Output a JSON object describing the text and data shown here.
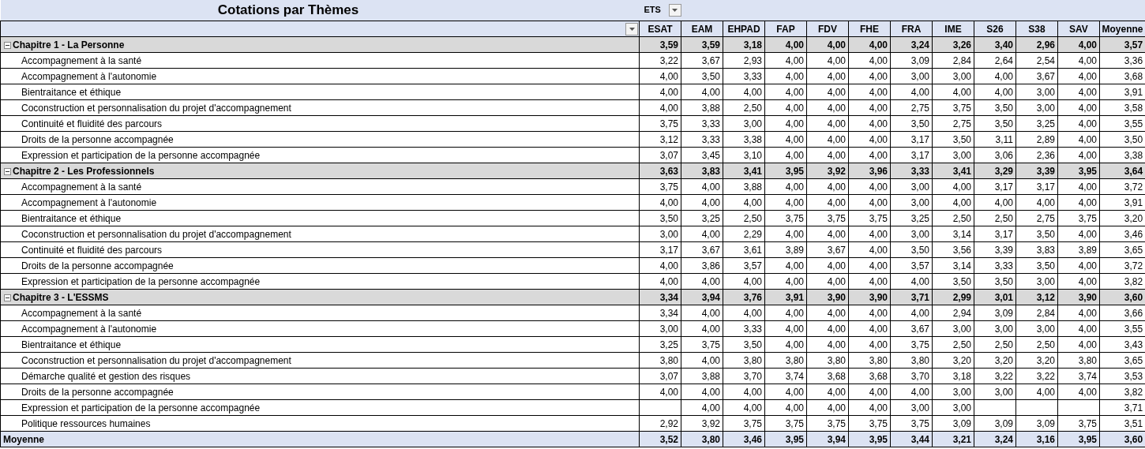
{
  "title": "Cotations par Thèmes",
  "filter": {
    "label": "ETS"
  },
  "columns": [
    "ESAT",
    "EAM",
    "EHPAD",
    "FAP",
    "FDV",
    "FHE",
    "FRA",
    "IME",
    "S26",
    "S38",
    "SAV",
    "Moyenne"
  ],
  "groups": [
    {
      "label": "Chapitre 1 - La Personne",
      "expanded": true,
      "values": [
        "3,59",
        "3,59",
        "3,18",
        "4,00",
        "4,00",
        "4,00",
        "3,24",
        "3,26",
        "3,40",
        "2,96",
        "4,00",
        "3,57"
      ],
      "rows": [
        {
          "label": "Accompagnement à la santé",
          "values": [
            "3,22",
            "3,67",
            "2,93",
            "4,00",
            "4,00",
            "4,00",
            "3,09",
            "2,84",
            "2,64",
            "2,54",
            "4,00",
            "3,36"
          ]
        },
        {
          "label": "Accompagnement à l'autonomie",
          "values": [
            "4,00",
            "3,50",
            "3,33",
            "4,00",
            "4,00",
            "4,00",
            "3,00",
            "3,00",
            "4,00",
            "3,67",
            "4,00",
            "3,68"
          ]
        },
        {
          "label": "Bientraitance et éthique",
          "values": [
            "4,00",
            "4,00",
            "4,00",
            "4,00",
            "4,00",
            "4,00",
            "4,00",
            "4,00",
            "4,00",
            "3,00",
            "4,00",
            "3,91"
          ]
        },
        {
          "label": "Coconstruction et personnalisation du projet d'accompagnement",
          "values": [
            "4,00",
            "3,88",
            "2,50",
            "4,00",
            "4,00",
            "4,00",
            "2,75",
            "3,75",
            "3,50",
            "3,00",
            "4,00",
            "3,58"
          ]
        },
        {
          "label": "Continuité et fluidité des parcours",
          "values": [
            "3,75",
            "3,33",
            "3,00",
            "4,00",
            "4,00",
            "4,00",
            "3,50",
            "2,75",
            "3,50",
            "3,25",
            "4,00",
            "3,55"
          ]
        },
        {
          "label": "Droits de la personne accompagnée",
          "values": [
            "3,12",
            "3,33",
            "3,38",
            "4,00",
            "4,00",
            "4,00",
            "3,17",
            "3,50",
            "3,11",
            "2,89",
            "4,00",
            "3,50"
          ]
        },
        {
          "label": "Expression et participation de la personne accompagnée",
          "values": [
            "3,07",
            "3,45",
            "3,10",
            "4,00",
            "4,00",
            "4,00",
            "3,17",
            "3,00",
            "3,06",
            "2,36",
            "4,00",
            "3,38"
          ]
        }
      ]
    },
    {
      "label": "Chapitre 2 - Les Professionnels",
      "expanded": true,
      "values": [
        "3,63",
        "3,83",
        "3,41",
        "3,95",
        "3,92",
        "3,96",
        "3,33",
        "3,41",
        "3,29",
        "3,39",
        "3,95",
        "3,64"
      ],
      "rows": [
        {
          "label": "Accompagnement à la santé",
          "values": [
            "3,75",
            "4,00",
            "3,88",
            "4,00",
            "4,00",
            "4,00",
            "3,00",
            "4,00",
            "3,17",
            "3,17",
            "4,00",
            "3,72"
          ]
        },
        {
          "label": "Accompagnement à l'autonomie",
          "values": [
            "4,00",
            "4,00",
            "4,00",
            "4,00",
            "4,00",
            "4,00",
            "3,00",
            "4,00",
            "4,00",
            "4,00",
            "4,00",
            "3,91"
          ]
        },
        {
          "label": "Bientraitance et éthique",
          "values": [
            "3,50",
            "3,25",
            "2,50",
            "3,75",
            "3,75",
            "3,75",
            "3,25",
            "2,50",
            "2,50",
            "2,75",
            "3,75",
            "3,20"
          ]
        },
        {
          "label": "Coconstruction et personnalisation du projet d'accompagnement",
          "values": [
            "3,00",
            "4,00",
            "2,29",
            "4,00",
            "4,00",
            "4,00",
            "3,00",
            "3,14",
            "3,17",
            "3,50",
            "4,00",
            "3,46"
          ]
        },
        {
          "label": "Continuité et fluidité des parcours",
          "values": [
            "3,17",
            "3,67",
            "3,61",
            "3,89",
            "3,67",
            "4,00",
            "3,50",
            "3,56",
            "3,39",
            "3,83",
            "3,89",
            "3,65"
          ]
        },
        {
          "label": "Droits de la personne accompagnée",
          "values": [
            "4,00",
            "3,86",
            "3,57",
            "4,00",
            "4,00",
            "4,00",
            "3,57",
            "3,14",
            "3,33",
            "3,50",
            "4,00",
            "3,72"
          ]
        },
        {
          "label": "Expression et participation de la personne accompagnée",
          "values": [
            "4,00",
            "4,00",
            "4,00",
            "4,00",
            "4,00",
            "4,00",
            "4,00",
            "3,50",
            "3,50",
            "3,00",
            "4,00",
            "3,82"
          ]
        }
      ]
    },
    {
      "label": "Chapitre 3 - L'ESSMS",
      "expanded": true,
      "values": [
        "3,34",
        "3,94",
        "3,76",
        "3,91",
        "3,90",
        "3,90",
        "3,71",
        "2,99",
        "3,01",
        "3,12",
        "3,90",
        "3,60"
      ],
      "rows": [
        {
          "label": "Accompagnement à la santé",
          "values": [
            "3,34",
            "4,00",
            "4,00",
            "4,00",
            "4,00",
            "4,00",
            "4,00",
            "2,94",
            "3,09",
            "2,84",
            "4,00",
            "3,66"
          ]
        },
        {
          "label": "Accompagnement à l'autonomie",
          "values": [
            "3,00",
            "4,00",
            "3,33",
            "4,00",
            "4,00",
            "4,00",
            "3,67",
            "3,00",
            "3,00",
            "3,00",
            "4,00",
            "3,55"
          ]
        },
        {
          "label": "Bientraitance et éthique",
          "values": [
            "3,25",
            "3,75",
            "3,50",
            "4,00",
            "4,00",
            "4,00",
            "3,75",
            "2,50",
            "2,50",
            "2,50",
            "4,00",
            "3,43"
          ]
        },
        {
          "label": "Coconstruction et personnalisation du projet d'accompagnement",
          "values": [
            "3,80",
            "4,00",
            "3,80",
            "3,80",
            "3,80",
            "3,80",
            "3,80",
            "3,20",
            "3,20",
            "3,20",
            "3,80",
            "3,65"
          ]
        },
        {
          "label": "Démarche qualité et gestion des risques",
          "values": [
            "3,07",
            "3,88",
            "3,70",
            "3,74",
            "3,68",
            "3,68",
            "3,70",
            "3,18",
            "3,22",
            "3,22",
            "3,74",
            "3,53"
          ]
        },
        {
          "label": "Droits de la personne accompagnée",
          "values": [
            "4,00",
            "4,00",
            "4,00",
            "4,00",
            "4,00",
            "4,00",
            "4,00",
            "3,00",
            "3,00",
            "4,00",
            "4,00",
            "3,82"
          ]
        },
        {
          "label": "Expression et participation de la personne accompagnée",
          "values": [
            {
              "kind": "blank"
            },
            {
              "kind": "number",
              "value": "4,00"
            },
            {
              "kind": "number",
              "value": "4,00"
            },
            {
              "kind": "number",
              "value": "4,00"
            },
            {
              "kind": "number",
              "value": "4,00"
            },
            {
              "kind": "number",
              "value": "4,00"
            },
            {
              "kind": "number",
              "value": "3,00"
            },
            {
              "kind": "number",
              "value": "3,00"
            },
            {
              "kind": "blank"
            },
            {
              "kind": "blank"
            },
            {
              "kind": "blank"
            },
            {
              "kind": "number",
              "value": "3,71"
            }
          ]
        },
        {
          "label": "Politique ressources humaines",
          "values": [
            "2,92",
            "3,92",
            "3,75",
            "3,75",
            "3,75",
            "3,75",
            "3,75",
            "3,09",
            "3,09",
            "3,09",
            "3,75",
            "3,51"
          ]
        }
      ]
    }
  ],
  "total": {
    "label": "Moyenne",
    "values": [
      "3,52",
      "3,80",
      "3,46",
      "3,95",
      "3,94",
      "3,95",
      "3,44",
      "3,21",
      "3,24",
      "3,16",
      "3,95",
      "3,60"
    ]
  }
}
